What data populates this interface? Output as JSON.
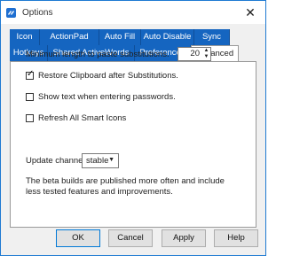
{
  "window": {
    "title": "Options"
  },
  "tabs": {
    "row1": [
      "Icon",
      "ActionPad",
      "Auto Fill",
      "Auto Disable",
      "Sync"
    ],
    "row2": [
      "Hotkeys",
      "Shared ActiveWords",
      "Preferences",
      "Advanced"
    ],
    "selected": "Advanced"
  },
  "panel": {
    "min_length_label": "Minimum length to paste substitutions.",
    "min_length_value": "20",
    "restore_clipboard_label": "Restore Clipboard after Substitutions.",
    "restore_clipboard_checked": true,
    "show_text_label": "Show text when entering passwords.",
    "show_text_checked": false,
    "refresh_icons_label": "Refresh All Smart Icons",
    "refresh_icons_checked": false,
    "update_channel_label": "Update channel",
    "update_channel_value": "stable",
    "note": "The beta builds are published more often and include less tested features and improvements."
  },
  "buttons": {
    "ok": "OK",
    "cancel": "Cancel",
    "apply": "Apply",
    "help": "Help"
  },
  "colors": {
    "tab_blue": "#1565c0",
    "accent": "#0078d7"
  },
  "icons": {
    "app": "app-icon",
    "close": "close-icon",
    "check": "check-mark-icon",
    "spin": "spin-arrows-icon",
    "dropdown": "chevron-down-icon"
  }
}
